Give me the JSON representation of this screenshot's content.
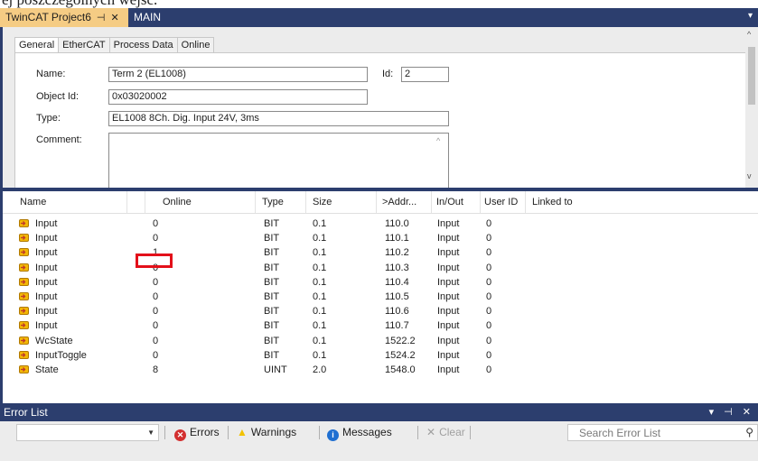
{
  "top_caption": "ej poszczególnych wejść.",
  "doc_tabs": {
    "project": "TwinCAT Project6",
    "pin": "⊣",
    "close": "✕",
    "main": "MAIN"
  },
  "prop_tabs": [
    "General",
    "EtherCAT",
    "Process Data",
    "Online"
  ],
  "general": {
    "name_label": "Name:",
    "name_value": "Term 2 (EL1008)",
    "id_label": "Id:",
    "id_value": "2",
    "objid_label": "Object Id:",
    "objid_value": "0x03020002",
    "type_label": "Type:",
    "type_value": "EL1008 8Ch. Dig. Input 24V, 3ms",
    "comment_label": "Comment:",
    "comment_value": ""
  },
  "table": {
    "columns": [
      "Name",
      "Online",
      "Type",
      "Size",
      ">Addr...",
      "In/Out",
      "User ID",
      "Linked to"
    ],
    "rows": [
      {
        "name": "Input",
        "online": "0",
        "type": "BIT",
        "size": "0.1",
        "addr": "110.0",
        "inout": "Input",
        "userid": "0"
      },
      {
        "name": "Input",
        "online": "0",
        "type": "BIT",
        "size": "0.1",
        "addr": "110.1",
        "inout": "Input",
        "userid": "0"
      },
      {
        "name": "Input",
        "online": "1",
        "type": "BIT",
        "size": "0.1",
        "addr": "110.2",
        "inout": "Input",
        "userid": "0"
      },
      {
        "name": "Input",
        "online": "0",
        "type": "BIT",
        "size": "0.1",
        "addr": "110.3",
        "inout": "Input",
        "userid": "0"
      },
      {
        "name": "Input",
        "online": "0",
        "type": "BIT",
        "size": "0.1",
        "addr": "110.4",
        "inout": "Input",
        "userid": "0"
      },
      {
        "name": "Input",
        "online": "0",
        "type": "BIT",
        "size": "0.1",
        "addr": "110.5",
        "inout": "Input",
        "userid": "0"
      },
      {
        "name": "Input",
        "online": "0",
        "type": "BIT",
        "size": "0.1",
        "addr": "110.6",
        "inout": "Input",
        "userid": "0"
      },
      {
        "name": "Input",
        "online": "0",
        "type": "BIT",
        "size": "0.1",
        "addr": "110.7",
        "inout": "Input",
        "userid": "0"
      },
      {
        "name": "WcState",
        "online": "0",
        "type": "BIT",
        "size": "0.1",
        "addr": "1522.2",
        "inout": "Input",
        "userid": "0"
      },
      {
        "name": "InputToggle",
        "online": "0",
        "type": "BIT",
        "size": "0.1",
        "addr": "1524.2",
        "inout": "Input",
        "userid": "0"
      },
      {
        "name": "State",
        "online": "8",
        "type": "UINT",
        "size": "2.0",
        "addr": "1548.0",
        "inout": "Input",
        "userid": "0"
      }
    ]
  },
  "error_list": {
    "title": "Error List",
    "window_buttons": "▾ ⊣ ✕",
    "errors_label": "Errors",
    "warnings_label": "Warnings",
    "messages_label": "Messages",
    "clear_label": "Clear",
    "search_placeholder": "Search Error List"
  },
  "colors": {
    "chrome": "#2c3e6e",
    "active_tab": "#f5cc84",
    "highlight": "#e3101a",
    "error_icon": "#d32f2f",
    "warning_icon": "#f2c200",
    "message_icon": "#1f6fd1"
  },
  "icons": {
    "variable": "input-variable-icon",
    "errors": "error-circle-icon",
    "warnings": "warning-triangle-icon",
    "messages": "info-circle-icon",
    "clear": "clear-x-icon",
    "search": "search-icon"
  }
}
